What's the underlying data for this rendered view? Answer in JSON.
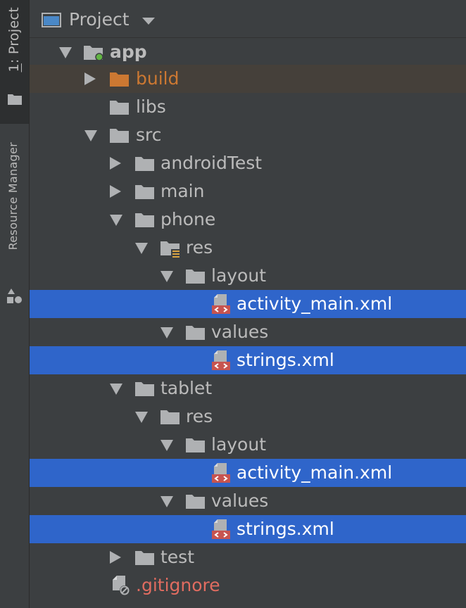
{
  "sidebar": {
    "project_tab": {
      "prefix": "1",
      "label": ": Project"
    },
    "resource_manager_tab": {
      "label": "Resource Manager"
    }
  },
  "header": {
    "title": "Project",
    "icon": "project-view-icon"
  },
  "colors": {
    "background": "#3c3f41",
    "selection": "#2f65ca",
    "excluded_row": "#45403a",
    "excluded_text": "#cc7832",
    "ignored_text": "#e06c60",
    "text": "#bbbbbb"
  },
  "tree": {
    "app": "app",
    "build": "build",
    "libs": "libs",
    "src": "src",
    "androidTest": "androidTest",
    "main": "main",
    "phone": "phone",
    "phone_res": "res",
    "phone_layout": "layout",
    "phone_layout_file": "activity_main.xml",
    "phone_values": "values",
    "phone_values_file": "strings.xml",
    "tablet": "tablet",
    "tablet_res": "res",
    "tablet_layout": "layout",
    "tablet_layout_file": "activity_main.xml",
    "tablet_values": "values",
    "tablet_values_file": "strings.xml",
    "test": "test",
    "gitignore": ".gitignore"
  }
}
